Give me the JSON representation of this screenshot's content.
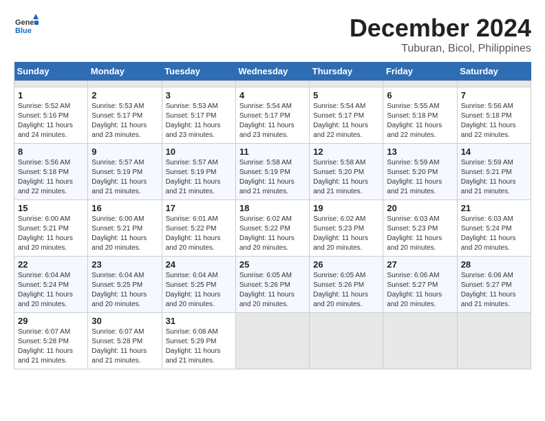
{
  "header": {
    "logo_general": "General",
    "logo_blue": "Blue",
    "title": "December 2024",
    "subtitle": "Tuburan, Bicol, Philippines"
  },
  "calendar": {
    "headers": [
      "Sunday",
      "Monday",
      "Tuesday",
      "Wednesday",
      "Thursday",
      "Friday",
      "Saturday"
    ],
    "weeks": [
      [
        {
          "day": "",
          "empty": true
        },
        {
          "day": "",
          "empty": true
        },
        {
          "day": "",
          "empty": true
        },
        {
          "day": "",
          "empty": true
        },
        {
          "day": "",
          "empty": true
        },
        {
          "day": "",
          "empty": true
        },
        {
          "day": "",
          "empty": true
        }
      ],
      [
        {
          "day": "1",
          "detail": "Sunrise: 5:52 AM\nSunset: 5:16 PM\nDaylight: 11 hours\nand 24 minutes."
        },
        {
          "day": "2",
          "detail": "Sunrise: 5:53 AM\nSunset: 5:17 PM\nDaylight: 11 hours\nand 23 minutes."
        },
        {
          "day": "3",
          "detail": "Sunrise: 5:53 AM\nSunset: 5:17 PM\nDaylight: 11 hours\nand 23 minutes."
        },
        {
          "day": "4",
          "detail": "Sunrise: 5:54 AM\nSunset: 5:17 PM\nDaylight: 11 hours\nand 23 minutes."
        },
        {
          "day": "5",
          "detail": "Sunrise: 5:54 AM\nSunset: 5:17 PM\nDaylight: 11 hours\nand 22 minutes."
        },
        {
          "day": "6",
          "detail": "Sunrise: 5:55 AM\nSunset: 5:18 PM\nDaylight: 11 hours\nand 22 minutes."
        },
        {
          "day": "7",
          "detail": "Sunrise: 5:56 AM\nSunset: 5:18 PM\nDaylight: 11 hours\nand 22 minutes."
        }
      ],
      [
        {
          "day": "8",
          "detail": "Sunrise: 5:56 AM\nSunset: 5:18 PM\nDaylight: 11 hours\nand 22 minutes."
        },
        {
          "day": "9",
          "detail": "Sunrise: 5:57 AM\nSunset: 5:19 PM\nDaylight: 11 hours\nand 21 minutes."
        },
        {
          "day": "10",
          "detail": "Sunrise: 5:57 AM\nSunset: 5:19 PM\nDaylight: 11 hours\nand 21 minutes."
        },
        {
          "day": "11",
          "detail": "Sunrise: 5:58 AM\nSunset: 5:19 PM\nDaylight: 11 hours\nand 21 minutes."
        },
        {
          "day": "12",
          "detail": "Sunrise: 5:58 AM\nSunset: 5:20 PM\nDaylight: 11 hours\nand 21 minutes."
        },
        {
          "day": "13",
          "detail": "Sunrise: 5:59 AM\nSunset: 5:20 PM\nDaylight: 11 hours\nand 21 minutes."
        },
        {
          "day": "14",
          "detail": "Sunrise: 5:59 AM\nSunset: 5:21 PM\nDaylight: 11 hours\nand 21 minutes."
        }
      ],
      [
        {
          "day": "15",
          "detail": "Sunrise: 6:00 AM\nSunset: 5:21 PM\nDaylight: 11 hours\nand 20 minutes."
        },
        {
          "day": "16",
          "detail": "Sunrise: 6:00 AM\nSunset: 5:21 PM\nDaylight: 11 hours\nand 20 minutes."
        },
        {
          "day": "17",
          "detail": "Sunrise: 6:01 AM\nSunset: 5:22 PM\nDaylight: 11 hours\nand 20 minutes."
        },
        {
          "day": "18",
          "detail": "Sunrise: 6:02 AM\nSunset: 5:22 PM\nDaylight: 11 hours\nand 20 minutes."
        },
        {
          "day": "19",
          "detail": "Sunrise: 6:02 AM\nSunset: 5:23 PM\nDaylight: 11 hours\nand 20 minutes."
        },
        {
          "day": "20",
          "detail": "Sunrise: 6:03 AM\nSunset: 5:23 PM\nDaylight: 11 hours\nand 20 minutes."
        },
        {
          "day": "21",
          "detail": "Sunrise: 6:03 AM\nSunset: 5:24 PM\nDaylight: 11 hours\nand 20 minutes."
        }
      ],
      [
        {
          "day": "22",
          "detail": "Sunrise: 6:04 AM\nSunset: 5:24 PM\nDaylight: 11 hours\nand 20 minutes."
        },
        {
          "day": "23",
          "detail": "Sunrise: 6:04 AM\nSunset: 5:25 PM\nDaylight: 11 hours\nand 20 minutes."
        },
        {
          "day": "24",
          "detail": "Sunrise: 6:04 AM\nSunset: 5:25 PM\nDaylight: 11 hours\nand 20 minutes."
        },
        {
          "day": "25",
          "detail": "Sunrise: 6:05 AM\nSunset: 5:26 PM\nDaylight: 11 hours\nand 20 minutes."
        },
        {
          "day": "26",
          "detail": "Sunrise: 6:05 AM\nSunset: 5:26 PM\nDaylight: 11 hours\nand 20 minutes."
        },
        {
          "day": "27",
          "detail": "Sunrise: 6:06 AM\nSunset: 5:27 PM\nDaylight: 11 hours\nand 20 minutes."
        },
        {
          "day": "28",
          "detail": "Sunrise: 6:06 AM\nSunset: 5:27 PM\nDaylight: 11 hours\nand 21 minutes."
        }
      ],
      [
        {
          "day": "29",
          "detail": "Sunrise: 6:07 AM\nSunset: 5:28 PM\nDaylight: 11 hours\nand 21 minutes."
        },
        {
          "day": "30",
          "detail": "Sunrise: 6:07 AM\nSunset: 5:28 PM\nDaylight: 11 hours\nand 21 minutes."
        },
        {
          "day": "31",
          "detail": "Sunrise: 6:08 AM\nSunset: 5:29 PM\nDaylight: 11 hours\nand 21 minutes."
        },
        {
          "day": "",
          "empty": true
        },
        {
          "day": "",
          "empty": true
        },
        {
          "day": "",
          "empty": true
        },
        {
          "day": "",
          "empty": true
        }
      ]
    ]
  }
}
